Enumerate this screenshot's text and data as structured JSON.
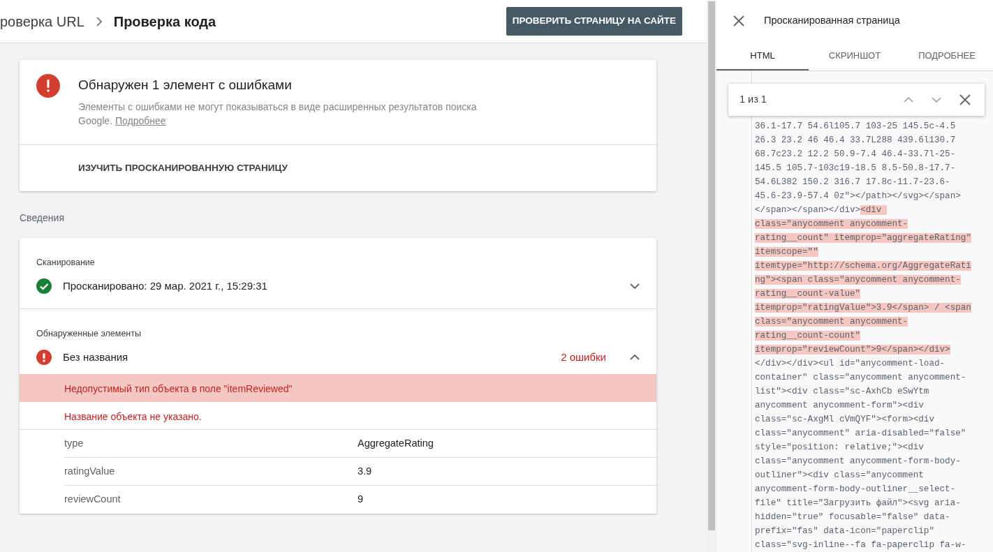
{
  "header": {
    "breadcrumbs": [
      {
        "label": "роверка URL",
        "current": false
      },
      {
        "label": "Проверка кода",
        "current": true
      }
    ],
    "action_button": "ПРОВЕРИТЬ СТРАНИЦУ НА САЙТЕ"
  },
  "summary": {
    "title": "Обнаружен 1 элемент с ошибками",
    "description": "Элементы с ошибками не могут показываться в виде расширенных результатов поиска Google.",
    "link": "Подробнее",
    "action": "ИЗУЧИТЬ ПРОСКАНИРОВАННУЮ СТРАНИЦУ"
  },
  "details": {
    "heading": "Сведения",
    "sections": [
      {
        "label": "Сканирование",
        "item": {
          "kind": "ok",
          "text": "Просканировано: 29 мар. 2021 г., 15:29:31",
          "expanded": false
        }
      },
      {
        "label": "Обнаруженные элементы",
        "item": {
          "kind": "error",
          "text": "Без названия",
          "count": "2 ошибки",
          "expanded": true,
          "errors": [
            {
              "text": "Недопустимый тип объекта в поле \"itemReviewed\"",
              "selected": true
            },
            {
              "text": "Название объекта не указано.",
              "selected": false
            }
          ],
          "properties": [
            {
              "name": "type",
              "value": "AggregateRating"
            },
            {
              "name": "ratingValue",
              "value": "3.9"
            },
            {
              "name": "reviewCount",
              "value": "9"
            }
          ]
        }
      }
    ]
  },
  "panel": {
    "title": "Просканированная страница",
    "tabs": [
      {
        "label": "HTML",
        "selected": true
      },
      {
        "label": "СКРИНШОТ",
        "selected": false
      },
      {
        "label": "ПОДРОБНЕЕ",
        "selected": false
      }
    ],
    "search": {
      "result": "1 из 1"
    },
    "code_lines": [
      {
        "segments": [
          {
            "text": "36.1-17.7 54.6l105.7 103-25 145.5c-4.5",
            "highlighted": false
          }
        ]
      },
      {
        "segments": [
          {
            "text": "26.3 23.2 46 46.4 33.7L288 439.6l130.7",
            "highlighted": false
          }
        ]
      },
      {
        "segments": [
          {
            "text": "68.7c23.2 12.2 50.9-7.4 46.4-33.7l-25-",
            "highlighted": false
          }
        ]
      },
      {
        "segments": [
          {
            "text": "145.5 105.7-103c19-18.5 8.5-50.8-17.7-",
            "highlighted": false
          }
        ]
      },
      {
        "segments": [
          {
            "text": "54.6L382 150.2 316.7 17.8c-11.7-23.6-",
            "highlighted": false
          }
        ]
      },
      {
        "segments": [
          {
            "text": "45.6-23.9-57.4 0z\"></path></svg></span>",
            "highlighted": false
          }
        ]
      },
      {
        "segments": [
          {
            "text": "</span></span></div>",
            "highlighted": false
          },
          {
            "text": "<div ",
            "highlighted": true
          }
        ]
      },
      {
        "segments": [
          {
            "text": "class=\"anycomment anycomment-",
            "highlighted": true
          }
        ]
      },
      {
        "segments": [
          {
            "text": "rating__count\" itemprop=\"aggregateRating\"",
            "highlighted": true
          }
        ]
      },
      {
        "segments": [
          {
            "text": "itemscope=\"\"",
            "highlighted": true
          }
        ]
      },
      {
        "segments": [
          {
            "text": "itemtype=\"http://schema.org/AggregateRati",
            "highlighted": true
          }
        ]
      },
      {
        "segments": [
          {
            "text": "ng\"><span class=\"anycomment anycomment-",
            "highlighted": true
          }
        ]
      },
      {
        "segments": [
          {
            "text": "rating__count-value\"",
            "highlighted": true
          }
        ]
      },
      {
        "segments": [
          {
            "text": "itemprop=\"ratingValue\">3.9</span> / <span",
            "highlighted": true
          }
        ]
      },
      {
        "segments": [
          {
            "text": "class=\"anycomment anycomment-",
            "highlighted": true
          }
        ]
      },
      {
        "segments": [
          {
            "text": "rating__count-count\"",
            "highlighted": true
          }
        ]
      },
      {
        "segments": [
          {
            "text": "itemprop=\"reviewCount\">9</span></div>",
            "highlighted": true
          }
        ]
      },
      {
        "segments": [
          {
            "text": "</div></div><ul id=\"anycomment-load-",
            "highlighted": false
          }
        ]
      },
      {
        "segments": [
          {
            "text": "container\" class=\"anycomment anycomment-",
            "highlighted": false
          }
        ]
      },
      {
        "segments": [
          {
            "text": "list\"><div class=\"sc-AxhCb eSwYtm",
            "highlighted": false
          }
        ]
      },
      {
        "segments": [
          {
            "text": "anycomment anycomment-form\"><div",
            "highlighted": false
          }
        ]
      },
      {
        "segments": [
          {
            "text": "class=\"sc-AxgMl cVmQYF\"><form><div",
            "highlighted": false
          }
        ]
      },
      {
        "segments": [
          {
            "text": "class=\"anycomment\" aria-disabled=\"false\"",
            "highlighted": false
          }
        ]
      },
      {
        "segments": [
          {
            "text": "style=\"position: relative;\"><div",
            "highlighted": false
          }
        ]
      },
      {
        "segments": [
          {
            "text": "class=\"anycomment anycomment-form-body-",
            "highlighted": false
          }
        ]
      },
      {
        "segments": [
          {
            "text": "outliner\"><div class=\"anycomment",
            "highlighted": false
          }
        ]
      },
      {
        "segments": [
          {
            "text": "anycomment-form-body-outliner__select-",
            "highlighted": false
          }
        ]
      },
      {
        "segments": [
          {
            "text": "file\" title=\"Загрузить файл\"><svg aria-",
            "highlighted": false
          }
        ]
      },
      {
        "segments": [
          {
            "text": "hidden=\"true\" focusable=\"false\" data-",
            "highlighted": false
          }
        ]
      },
      {
        "segments": [
          {
            "text": "prefix=\"fas\" data-icon=\"paperclip\"",
            "highlighted": false
          }
        ]
      },
      {
        "segments": [
          {
            "text": "class=\"svg-inline--fa fa-paperclip fa-w-",
            "highlighted": false
          }
        ]
      }
    ]
  }
}
